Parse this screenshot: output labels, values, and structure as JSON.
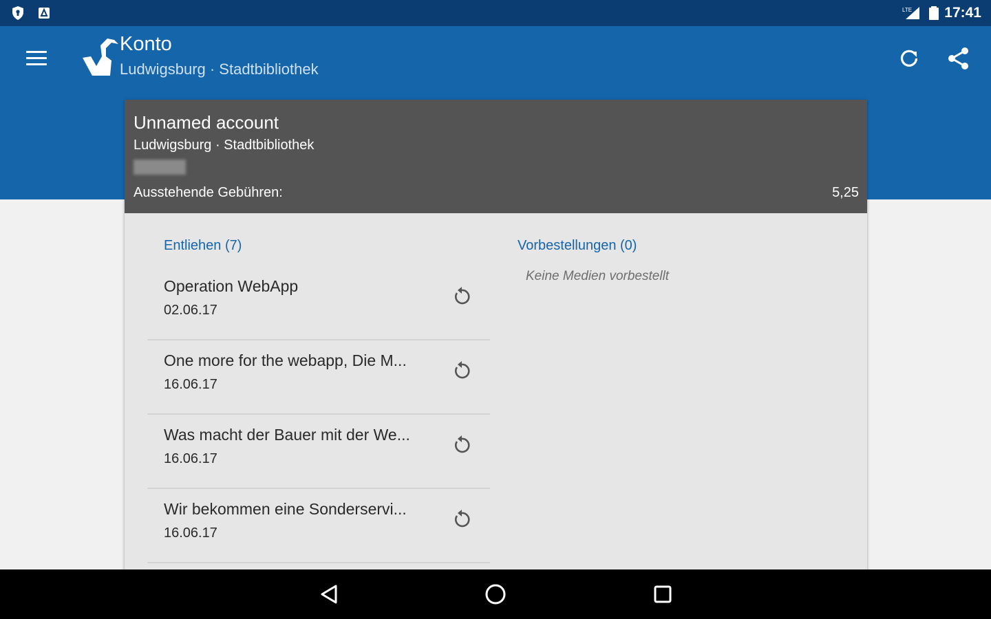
{
  "status_bar": {
    "time": "17:41"
  },
  "app_bar": {
    "title": "Konto",
    "subtitle": "Ludwigsburg · Stadtbibliothek"
  },
  "account": {
    "name": "Unnamed account",
    "library": "Ludwigsburg · Stadtbibliothek",
    "fees_label": "Ausstehende Gebühren:",
    "fees_value": "5,25"
  },
  "loans": {
    "title": "Entliehen (7)",
    "items": [
      {
        "title": "Operation WebApp",
        "date": "02.06.17"
      },
      {
        "title": "One more for the webapp, Die M...",
        "date": "16.06.17"
      },
      {
        "title": "Was macht der Bauer mit der We...",
        "date": "16.06.17"
      },
      {
        "title": "Wir bekommen eine Sonderservi...",
        "date": "16.06.17"
      }
    ]
  },
  "reservations": {
    "title": "Vorbestellungen (0)",
    "empty_text": "Keine Medien vorbestellt"
  },
  "colors": {
    "status_bar": "#0b3d73",
    "app_bar": "#1565ab",
    "card_header": "#545454",
    "accent": "#1565ab"
  }
}
